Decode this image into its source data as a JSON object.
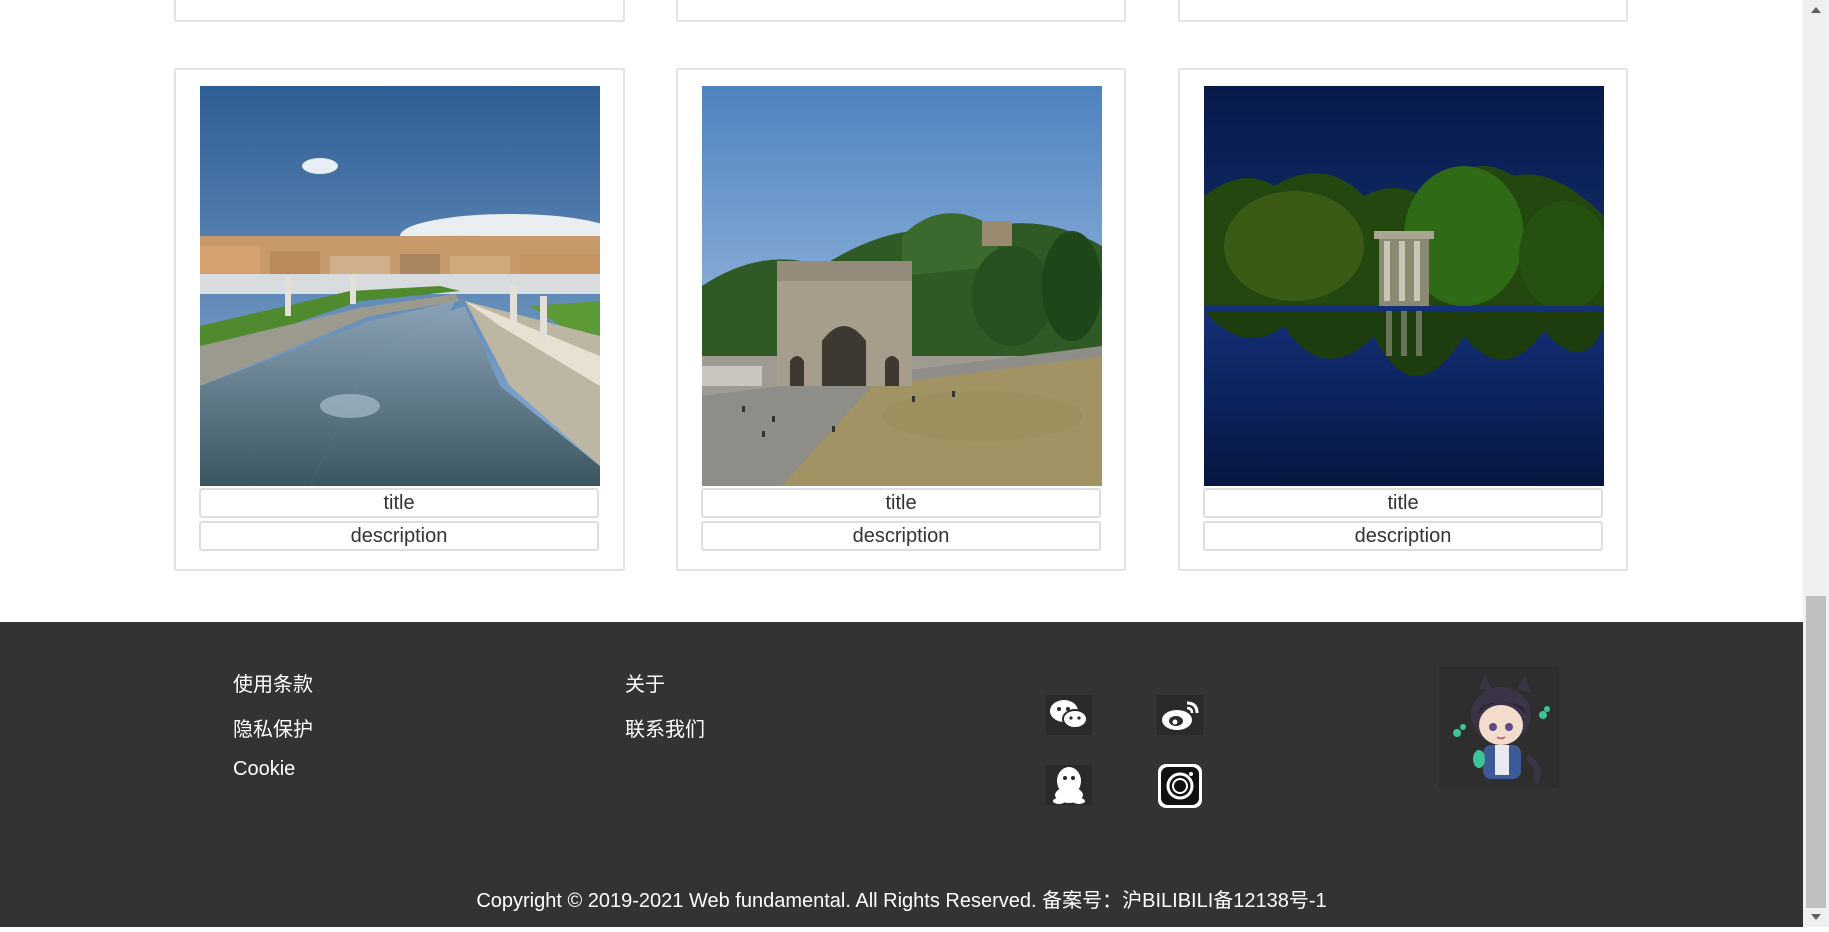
{
  "gallery": {
    "cards": [
      {
        "title": "title",
        "description": "description"
      },
      {
        "title": "title",
        "description": "description"
      },
      {
        "title": "title",
        "description": "description"
      }
    ]
  },
  "footer": {
    "links_col1": [
      "使用条款",
      "隐私保护",
      "Cookie"
    ],
    "links_col2": [
      "关于",
      "联系我们"
    ],
    "social_icons": [
      "wechat-icon",
      "weibo-icon",
      "qq-icon",
      "instagram-icon"
    ],
    "copyright": "Copyright © 2019-2021 Web fundamental. All Rights Reserved. 备案号：沪BILIBILI备12138号-1"
  },
  "colors": {
    "footer_bg": "#333333",
    "card_border": "#e3e3e3"
  }
}
